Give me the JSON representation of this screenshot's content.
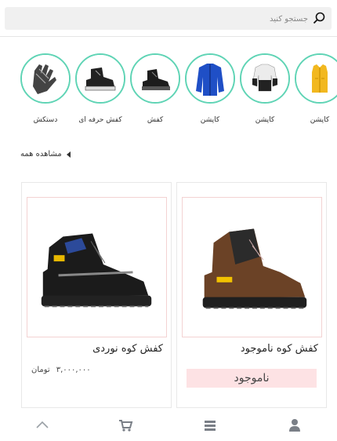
{
  "search": {
    "placeholder": "جستجو کنید",
    "icon": "search-icon"
  },
  "stories": [
    {
      "label": "کاپشن",
      "image": "yellow-vest"
    },
    {
      "label": "کاپشن",
      "image": "black-white-jacket"
    },
    {
      "label": "کاپشن",
      "image": "blue-jacket"
    },
    {
      "label": "کفش",
      "image": "black-boot"
    },
    {
      "label": "کفش حرفه ای",
      "image": "black-boot-pro"
    },
    {
      "label": "دستکش",
      "image": "gloves"
    }
  ],
  "see_all": {
    "label": "مشاهده همه"
  },
  "products": [
    {
      "title": "کفش کوه ناموجود",
      "status": "ناموجود",
      "image": "brown-hiking-boot"
    },
    {
      "title": "کفش کوه نوردی",
      "price": "۳,۰۰۰,۰۰۰",
      "currency": "تومان",
      "image": "black-hiking-boot"
    }
  ],
  "bottom_nav": [
    {
      "icon": "user-icon"
    },
    {
      "icon": "menu-icon"
    },
    {
      "icon": "cart-icon"
    },
    {
      "icon": "chevron-up-icon"
    }
  ],
  "colors": {
    "story_ring": "#5fd4b5",
    "unavailable_bg": "#fde2e4",
    "search_bg": "#f0f0f0"
  }
}
